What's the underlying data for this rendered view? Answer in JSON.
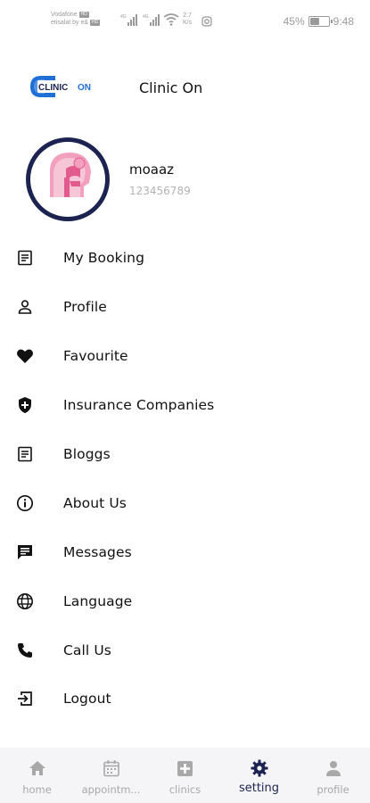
{
  "status_bar": {
    "carrier1": "Vodafone",
    "carrier1_badge": "HD",
    "carrier2": "etisalat by e&",
    "carrier2_badge": "HD",
    "net_speed": "2.7",
    "net_speed_unit": "K/s",
    "battery_percent": "45%",
    "battery_level": 0.45,
    "time": "9:48"
  },
  "header": {
    "logo_text_part1": "CLINIC",
    "logo_text_part2": "ON",
    "app_name": "Clinic On"
  },
  "user": {
    "name": "moaaz",
    "id": "123456789"
  },
  "menu": {
    "items": [
      {
        "label": "My Booking",
        "icon": "booking-list-icon"
      },
      {
        "label": "Profile",
        "icon": "person-icon"
      },
      {
        "label": "Favourite",
        "icon": "heart-icon"
      },
      {
        "label": "Insurance Companies",
        "icon": "shield-plus-icon"
      },
      {
        "label": "Bloggs",
        "icon": "article-icon"
      },
      {
        "label": "About Us",
        "icon": "info-icon"
      },
      {
        "label": "Messages",
        "icon": "message-icon"
      },
      {
        "label": "Language",
        "icon": "globe-icon"
      },
      {
        "label": "Call Us",
        "icon": "phone-icon"
      },
      {
        "label": "Logout",
        "icon": "logout-icon"
      }
    ]
  },
  "bottom_nav": {
    "items": [
      {
        "label": "home",
        "icon": "home-icon"
      },
      {
        "label": "appointm...",
        "icon": "calendar-icon"
      },
      {
        "label": "clinics",
        "icon": "clinic-plus-icon"
      },
      {
        "label": "setting",
        "icon": "gear-icon",
        "active": true
      },
      {
        "label": "profile",
        "icon": "person-icon"
      }
    ],
    "active_color": "#1c2350",
    "inactive_color": "#a8a8a8"
  },
  "colors": {
    "brand_navy": "#1c2350",
    "brand_blue": "#1f6fd6",
    "avatar_pink": "#f2a0bd"
  }
}
